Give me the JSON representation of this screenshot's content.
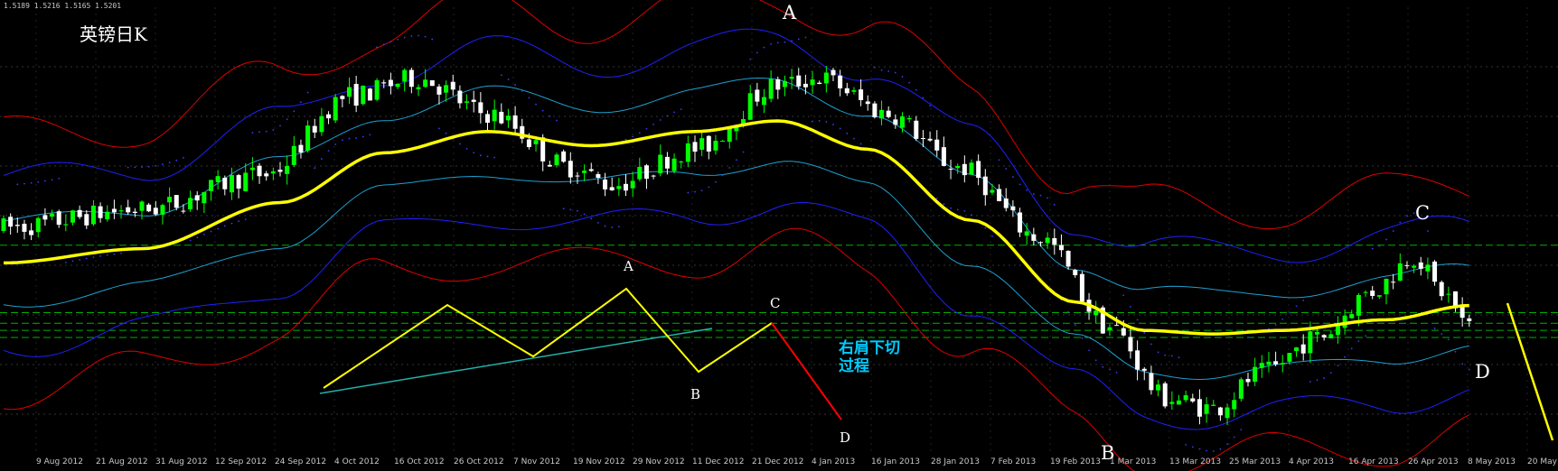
{
  "header": {
    "ohlc_readout": "1.5189 1.5216 1.5165 1.5201",
    "title": "英镑日K"
  },
  "annotation": {
    "line1": "右肩下切",
    "line2": "过程"
  },
  "markers": {
    "main": [
      "A",
      "B",
      "C",
      "D"
    ],
    "schematic": [
      "A",
      "B",
      "C",
      "D"
    ]
  },
  "colors": {
    "background": "#000000",
    "bull_candle": "#00ff00",
    "bear_candle": "#ffffff",
    "middle_line": "#ffff00",
    "inner_band": "#1ea0d0",
    "mid_band": "#2020ff",
    "outer_band": "#e00000",
    "hline": "#00b000",
    "schematic_line": "#ffff00",
    "schematic_trend": "#20b2aa",
    "schematic_drop": "#ff0000",
    "projection": "#ffff00"
  },
  "chart_data": {
    "type": "candlestick",
    "title": "英镑日K",
    "x_tick_labels": [
      "9 Aug 2012",
      "21 Aug 2012",
      "31 Aug 2012",
      "12 Sep 2012",
      "24 Sep 2012",
      "4 Oct 2012",
      "16 Oct 2012",
      "26 Oct 2012",
      "7 Nov 2012",
      "19 Nov 2012",
      "29 Nov 2012",
      "11 Dec 2012",
      "21 Dec 2012",
      "4 Jan 2013",
      "16 Jan 2013",
      "28 Jan 2013",
      "7 Feb 2013",
      "19 Feb 2013",
      "1 Mar 2013",
      "13 Mar 2013",
      "25 Mar 2013",
      "4 Apr 2013",
      "16 Apr 2013",
      "26 Apr 2013",
      "8 May 2013",
      "20 May 2013"
    ],
    "price_path_control_points": [
      [
        0,
        1.543
      ],
      [
        20,
        1.548
      ],
      [
        38,
        1.558
      ],
      [
        50,
        1.58
      ],
      [
        60,
        1.585
      ],
      [
        70,
        1.575
      ],
      [
        82,
        1.56
      ],
      [
        88,
        1.555
      ],
      [
        100,
        1.565
      ],
      [
        112,
        1.583
      ],
      [
        118,
        1.585
      ],
      [
        128,
        1.575
      ],
      [
        138,
        1.56
      ],
      [
        150,
        1.54
      ],
      [
        160,
        1.515
      ],
      [
        168,
        1.495
      ],
      [
        175,
        1.492
      ],
      [
        182,
        1.502
      ],
      [
        190,
        1.512
      ],
      [
        198,
        1.525
      ],
      [
        204,
        1.535
      ],
      [
        208,
        1.525
      ],
      [
        212,
        1.515
      ]
    ],
    "price_range": [
      1.48,
      1.605
    ],
    "horizontal_levels": [
      1.538,
      1.519,
      1.516,
      1.514,
      1.512
    ],
    "middle_line_control_points": [
      [
        0,
        1.533
      ],
      [
        20,
        1.537
      ],
      [
        40,
        1.55
      ],
      [
        55,
        1.564
      ],
      [
        70,
        1.57
      ],
      [
        85,
        1.566
      ],
      [
        100,
        1.57
      ],
      [
        112,
        1.573
      ],
      [
        125,
        1.565
      ],
      [
        140,
        1.545
      ],
      [
        155,
        1.522
      ],
      [
        165,
        1.514
      ],
      [
        175,
        1.513
      ],
      [
        185,
        1.514
      ],
      [
        200,
        1.517
      ],
      [
        212,
        1.521
      ]
    ],
    "band_offsets": {
      "inner": 0.011,
      "mid": 0.023,
      "outer": 0.035
    },
    "schematic_path": [
      "start",
      "peak",
      "trough",
      "A",
      "B",
      "C",
      "D"
    ]
  }
}
